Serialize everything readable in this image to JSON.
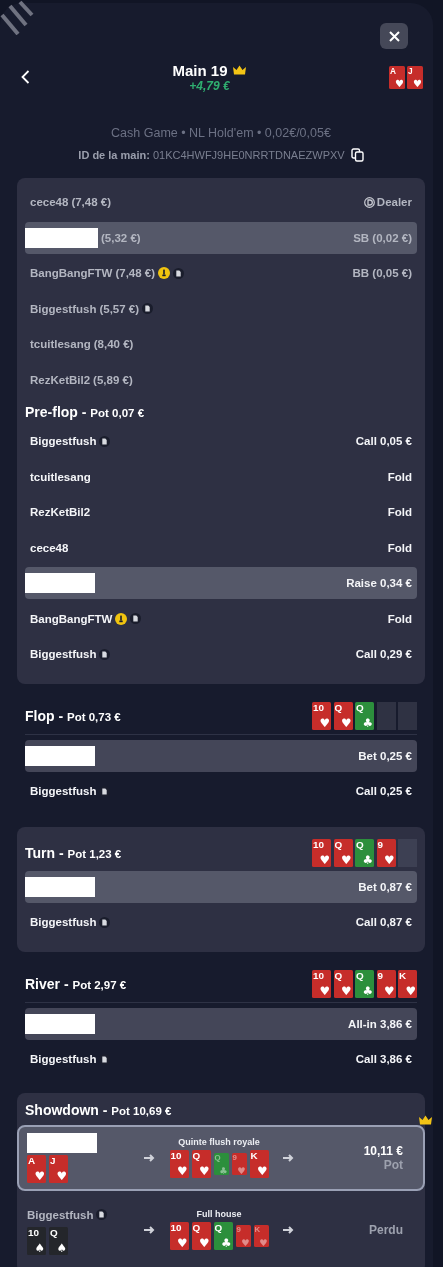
{
  "header": {
    "title": "Main 19",
    "winner": true,
    "result": "+4,79 €",
    "hole_cards": [
      {
        "rank": "A",
        "suit": "♥",
        "color": "#c62d2a"
      },
      {
        "rank": "J",
        "suit": "♥",
        "color": "#c62d2a"
      }
    ]
  },
  "info": {
    "game": "Cash Game • NL Hold'em • 0,02€/0,05€",
    "id_label": "ID de la main:",
    "id_value": "01KC4HWFJ9HE0NRRTDNAEZWPXV"
  },
  "seats": [
    {
      "name": "cece48",
      "stack": "(7,48 €)",
      "hero": false,
      "info": false,
      "note": false,
      "dealer": true,
      "position": "Dealer"
    },
    {
      "stack": "(5,32 €)",
      "hero": true,
      "info": false,
      "note": false,
      "dealer": false,
      "position": "SB (0,02 €)"
    },
    {
      "name": "BangBangFTW",
      "stack": "(7,48 €)",
      "hero": false,
      "info": true,
      "note": true,
      "dealer": false,
      "position": "BB (0,05 €)"
    },
    {
      "name": "Biggestfush",
      "stack": "(5,57 €)",
      "hero": false,
      "info": false,
      "note": true,
      "dealer": false
    },
    {
      "name": "tcuitlesang",
      "stack": "(8,40 €)",
      "hero": false,
      "info": false,
      "note": false,
      "dealer": false
    },
    {
      "name": "RezKetBil2",
      "stack": "(5,89 €)",
      "hero": false,
      "info": false,
      "note": false,
      "dealer": false
    }
  ],
  "streets": [
    {
      "name": "Pre-flop -",
      "pot": "Pot 0,07 €",
      "panel": true,
      "actions": [
        {
          "player": "Biggestfush",
          "hero": false,
          "info": false,
          "note": true,
          "action": "Call 0,05 €"
        },
        {
          "player": "tcuitlesang",
          "hero": false,
          "info": false,
          "note": false,
          "action": "Fold"
        },
        {
          "player": "RezKetBil2",
          "hero": false,
          "info": false,
          "note": false,
          "action": "Fold"
        },
        {
          "player": "cece48",
          "hero": false,
          "info": false,
          "note": false,
          "action": "Fold"
        },
        {
          "hero": true,
          "info": false,
          "note": false,
          "action": "Raise 0,34 €"
        },
        {
          "player": "BangBangFTW",
          "hero": false,
          "info": true,
          "note": true,
          "action": "Fold"
        },
        {
          "player": "Biggestfush",
          "hero": false,
          "info": false,
          "note": true,
          "action": "Call 0,29 €"
        }
      ]
    },
    {
      "name": "Flop -",
      "pot": "Pot 0,73 €",
      "panel": false,
      "board": [
        {
          "rank": "10",
          "suit": "♥",
          "color": "#c62d2a"
        },
        {
          "rank": "Q",
          "suit": "♥",
          "color": "#c62d2a"
        },
        {
          "rank": "Q",
          "suit": "♣",
          "color": "#2c8f3c"
        }
      ],
      "actions": [
        {
          "hero": true,
          "info": false,
          "note": false,
          "action": "Bet 0,25 €"
        },
        {
          "player": "Biggestfush",
          "hero": false,
          "info": false,
          "note": true,
          "action": "Call 0,25 €"
        }
      ]
    },
    {
      "name": "Turn -",
      "pot": "Pot 1,23 €",
      "panel": true,
      "board": [
        {
          "rank": "10",
          "suit": "♥",
          "color": "#c62d2a"
        },
        {
          "rank": "Q",
          "suit": "♥",
          "color": "#c62d2a"
        },
        {
          "rank": "Q",
          "suit": "♣",
          "color": "#2c8f3c"
        },
        {
          "rank": "9",
          "suit": "♥",
          "color": "#c62d2a"
        }
      ],
      "actions": [
        {
          "hero": true,
          "info": false,
          "note": false,
          "action": "Bet 0,87 €"
        },
        {
          "player": "Biggestfush",
          "hero": false,
          "info": false,
          "note": true,
          "action": "Call 0,87 €"
        }
      ]
    },
    {
      "name": "River -",
      "pot": "Pot 2,97 €",
      "panel": false,
      "board": [
        {
          "rank": "10",
          "suit": "♥",
          "color": "#c62d2a"
        },
        {
          "rank": "Q",
          "suit": "♥",
          "color": "#c62d2a"
        },
        {
          "rank": "Q",
          "suit": "♣",
          "color": "#2c8f3c"
        },
        {
          "rank": "9",
          "suit": "♥",
          "color": "#c62d2a"
        },
        {
          "rank": "K",
          "suit": "♥",
          "color": "#c62d2a"
        }
      ],
      "actions": [
        {
          "hero": true,
          "info": false,
          "note": false,
          "action": "All-in 3,86 €"
        },
        {
          "player": "Biggestfush",
          "hero": false,
          "info": false,
          "note": true,
          "action": "Call 3,86 €"
        }
      ]
    }
  ],
  "showdown": {
    "name": "Showdown -",
    "pot": "Pot 10,69 €",
    "hands": [
      {
        "hero": true,
        "note": false,
        "winner": true,
        "hole": [
          {
            "rank": "A",
            "suit": "♥",
            "color": "#c62d2a"
          },
          {
            "rank": "J",
            "suit": "♥",
            "color": "#c62d2a"
          }
        ],
        "hand_name": "Quinte flush royale",
        "best": [
          {
            "rank": "10",
            "suit": "♥",
            "color": "#c62d2a",
            "used": true
          },
          {
            "rank": "Q",
            "suit": "♥",
            "color": "#c62d2a",
            "used": true
          },
          {
            "rank": "Q",
            "suit": "♣",
            "color": "#2c8f3c",
            "used": false
          },
          {
            "rank": "9",
            "suit": "♥",
            "color": "#c62d2a",
            "used": false
          },
          {
            "rank": "K",
            "suit": "♥",
            "color": "#c62d2a",
            "used": true
          }
        ],
        "amount": "10,11 €",
        "result": "Pot"
      },
      {
        "player": "Biggestfush",
        "hero": false,
        "note": true,
        "winner": false,
        "hole": [
          {
            "rank": "10",
            "suit": "♠",
            "color": "#24262b"
          },
          {
            "rank": "Q",
            "suit": "♠",
            "color": "#24262b"
          }
        ],
        "hand_name": "Full house",
        "best": [
          {
            "rank": "10",
            "suit": "♥",
            "color": "#c62d2a",
            "used": true
          },
          {
            "rank": "Q",
            "suit": "♥",
            "color": "#c62d2a",
            "used": true
          },
          {
            "rank": "Q",
            "suit": "♣",
            "color": "#2c8f3c",
            "used": true
          },
          {
            "rank": "9",
            "suit": "♥",
            "color": "#c62d2a",
            "used": false
          },
          {
            "rank": "K",
            "suit": "♥",
            "color": "#c62d2a",
            "used": false
          }
        ],
        "result": "Perdu"
      }
    ]
  }
}
